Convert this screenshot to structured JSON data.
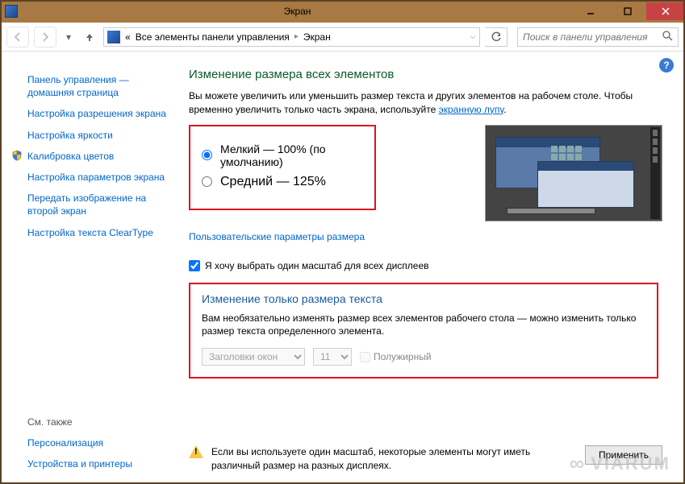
{
  "window": {
    "title": "Экран",
    "min_tooltip": "Свернуть",
    "max_tooltip": "Развернуть",
    "close_tooltip": "Закрыть"
  },
  "nav": {
    "breadcrumb_prefix": "«",
    "breadcrumb1": "Все элементы панели управления",
    "breadcrumb2": "Экран",
    "search_placeholder": "Поиск в панели управления"
  },
  "sidebar": {
    "items": [
      "Панель управления — домашняя страница",
      "Настройка разрешения экрана",
      "Настройка яркости",
      "Калибровка цветов",
      "Настройка параметров экрана",
      "Передать изображение на второй экран",
      "Настройка текста ClearType"
    ],
    "see_also_heading": "См. также",
    "see_also": [
      "Персонализация",
      "Устройства и принтеры"
    ]
  },
  "main": {
    "h1": "Изменение размера всех элементов",
    "desc_pre": "Вы можете увеличить или уменьшить размер текста и других элементов на рабочем столе. Чтобы временно увеличить только часть экрана, используйте ",
    "desc_link": "экранную лупу",
    "desc_post": ".",
    "radio_small": "Мелкий — 100% (по умолчанию)",
    "radio_medium": "Средний — 125%",
    "custom_link": "Пользовательские параметры размера",
    "checkbox_single_scale": "Я хочу выбрать один масштаб для всех дисплеев",
    "text_section": {
      "h2": "Изменение только размера текста",
      "desc": "Вам необязательно изменять размер всех элементов рабочего стола — можно изменить только размер текста определенного элемента.",
      "dropdown_element": "Заголовки окон",
      "dropdown_size": "11",
      "bold_label": "Полужирный"
    },
    "warning": "Если вы используете один масштаб, некоторые элементы могут иметь различный размер на разных дисплеях.",
    "apply": "Применить"
  },
  "watermark": "VIARUM"
}
